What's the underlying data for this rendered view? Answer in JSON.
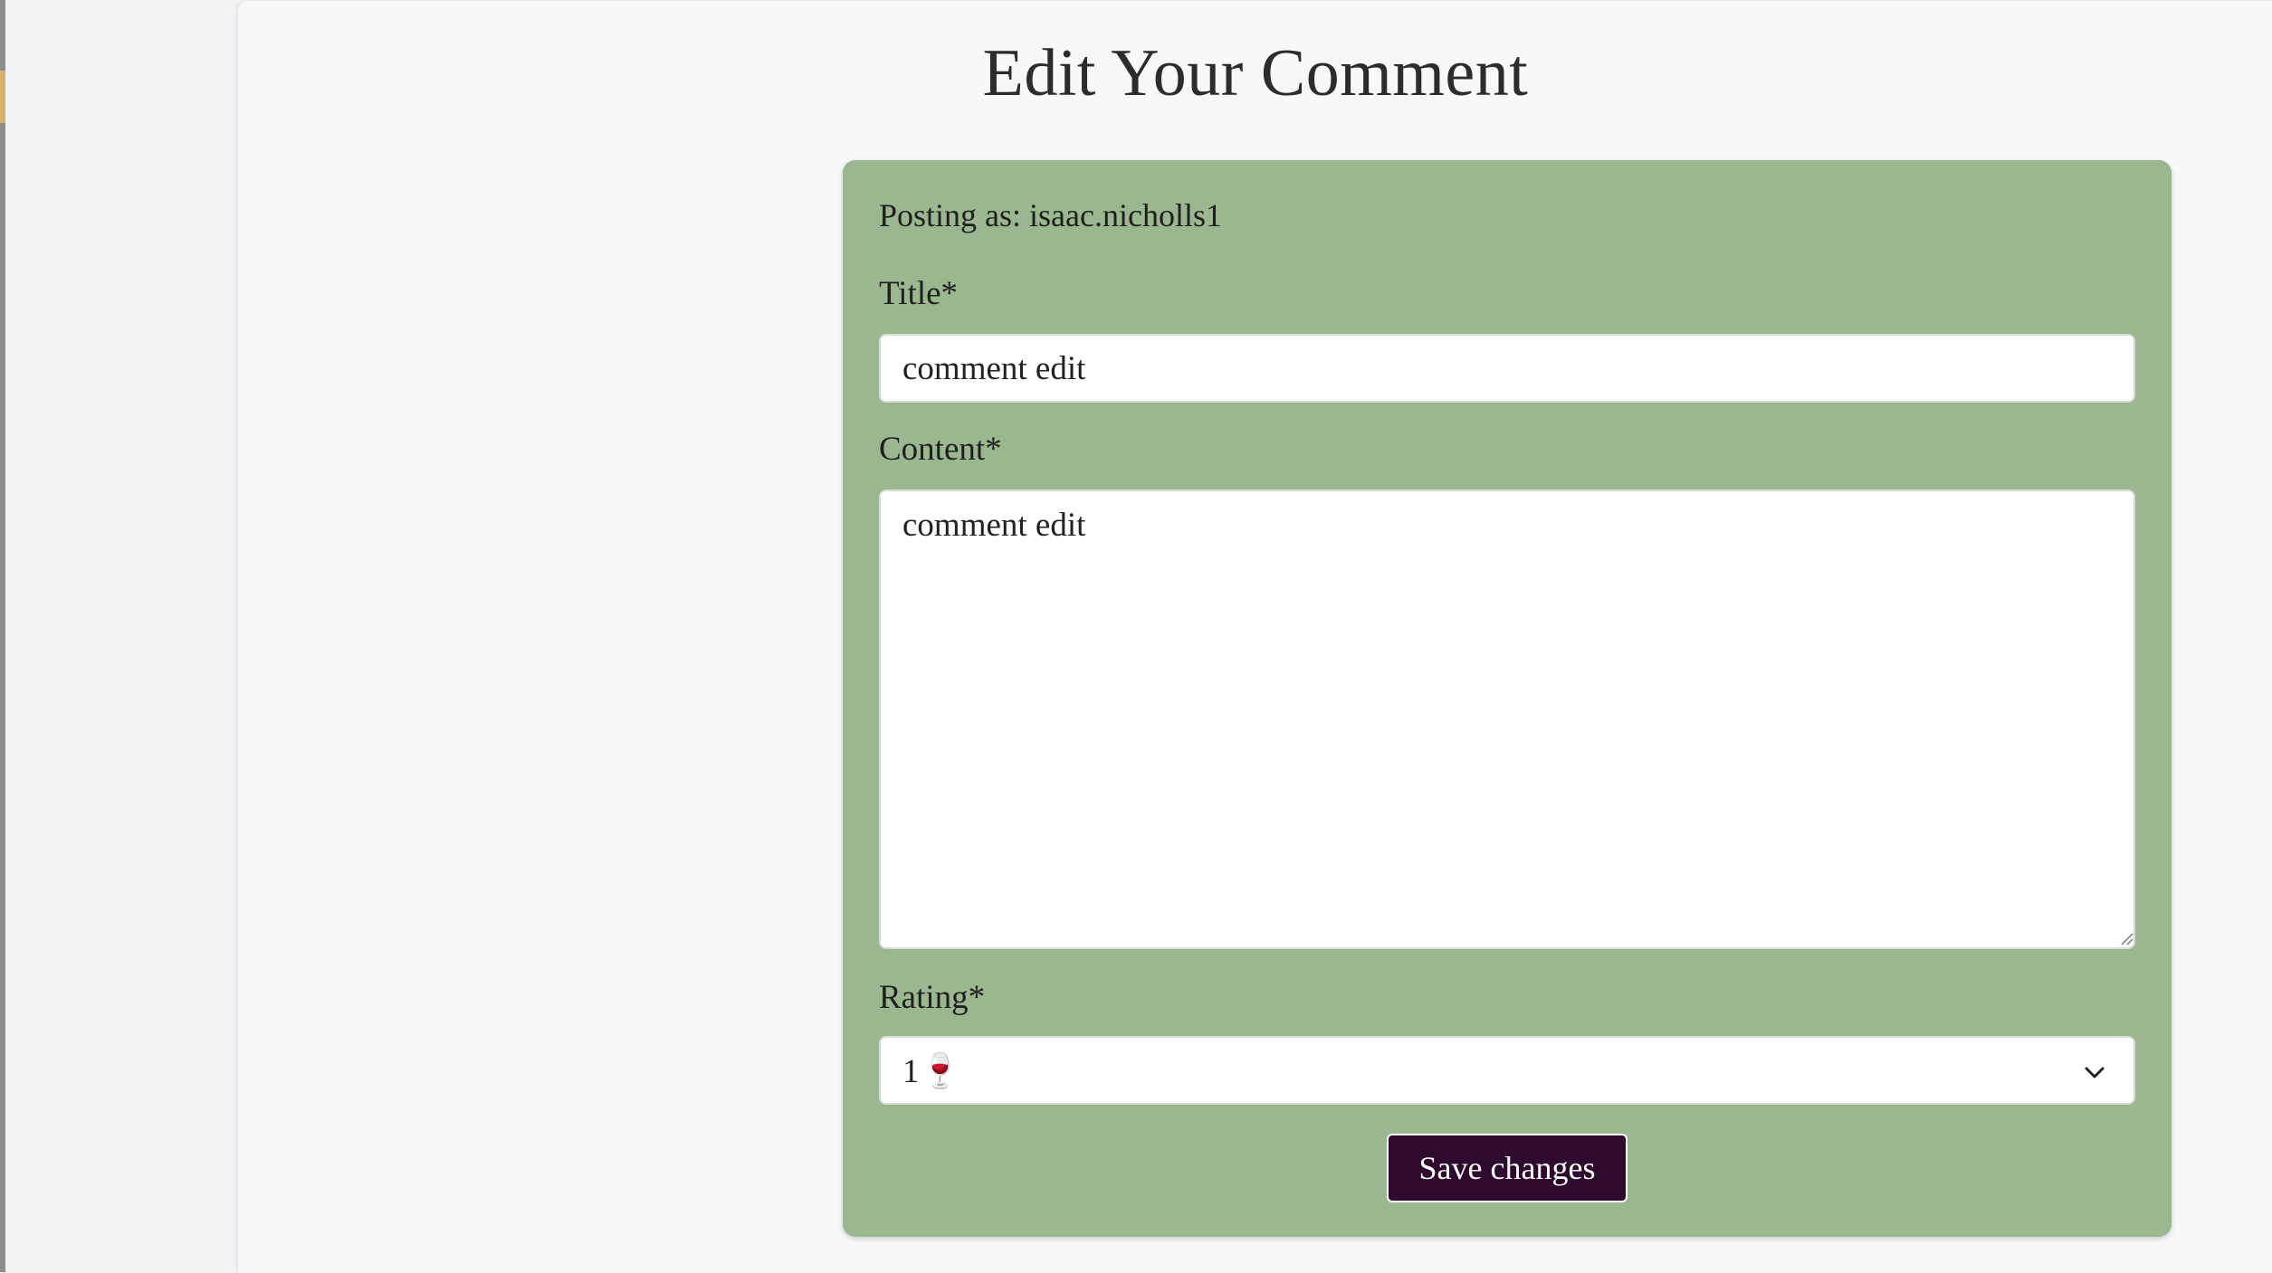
{
  "page": {
    "title": "Edit Your Comment"
  },
  "form": {
    "posting_as": "Posting as: isaac.nicholls1",
    "title_label": "Title*",
    "title_value": "comment edit",
    "content_label": "Content*",
    "content_value": "comment edit",
    "rating_label": "Rating*",
    "rating_value": "1🍷",
    "save_label": "Save changes"
  },
  "colors": {
    "form_background": "#9bb78f",
    "button_background": "#2e0a2e",
    "page_background": "#f7f8fa"
  },
  "icons": {
    "rating_dropdown": "chevron-down-icon",
    "textarea_resize": "resize-grip-icon"
  }
}
